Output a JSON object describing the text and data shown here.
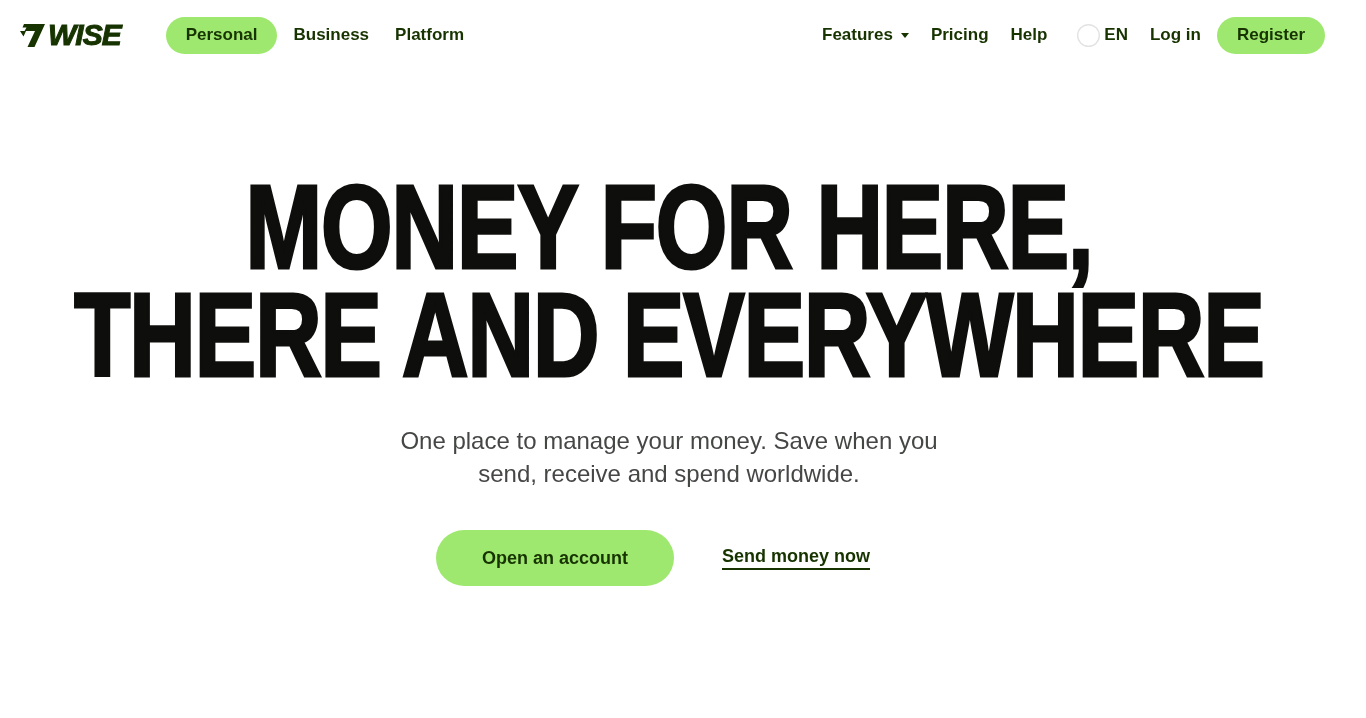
{
  "nav": {
    "logo": "WISE",
    "tabs": [
      {
        "label": "Personal",
        "selected": true
      },
      {
        "label": "Business",
        "selected": false
      },
      {
        "label": "Platform",
        "selected": false
      }
    ],
    "links": [
      {
        "label": "Features",
        "kind": "dropdown"
      },
      {
        "label": "Pricing",
        "kind": "link"
      },
      {
        "label": "Help",
        "kind": "link"
      }
    ],
    "language": "EN",
    "login": "Log in",
    "register": "Register"
  },
  "hero": {
    "headline": [
      "MONEY FOR HERE,",
      "THERE AND EVERYWHERE"
    ],
    "subtitle": "One place to manage your money. Save when you send, receive and spend worldwide.",
    "primary_button": "Open an account",
    "secondary_link": "Send money now"
  }
}
